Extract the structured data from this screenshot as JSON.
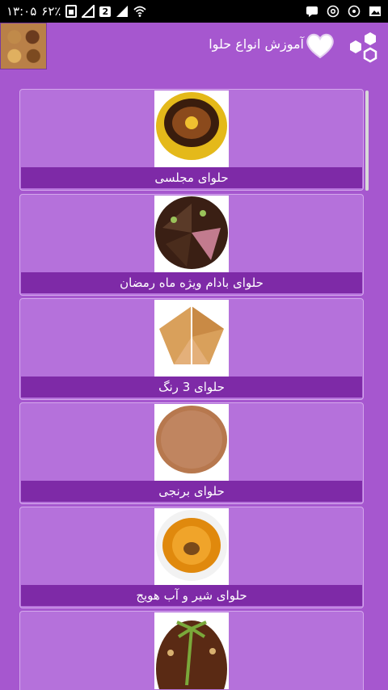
{
  "status_bar": {
    "time": "۱۳:۰۵",
    "battery": "۶۲٪",
    "sim_badge": "2"
  },
  "app_bar": {
    "title": "آموزش انواع حلوا"
  },
  "items": [
    {
      "label": "حلوای مجلسی"
    },
    {
      "label": "حلوای بادام ویژه ماه رمضان"
    },
    {
      "label": "حلوای 3 رنگ"
    },
    {
      "label": "حلوای برنجی"
    },
    {
      "label": "حلوای شیر و آب هویج"
    },
    {
      "label": ""
    }
  ],
  "colors": {
    "background": "#a657cf",
    "card": "#b571db",
    "label_bar": "#7e2aa7"
  }
}
